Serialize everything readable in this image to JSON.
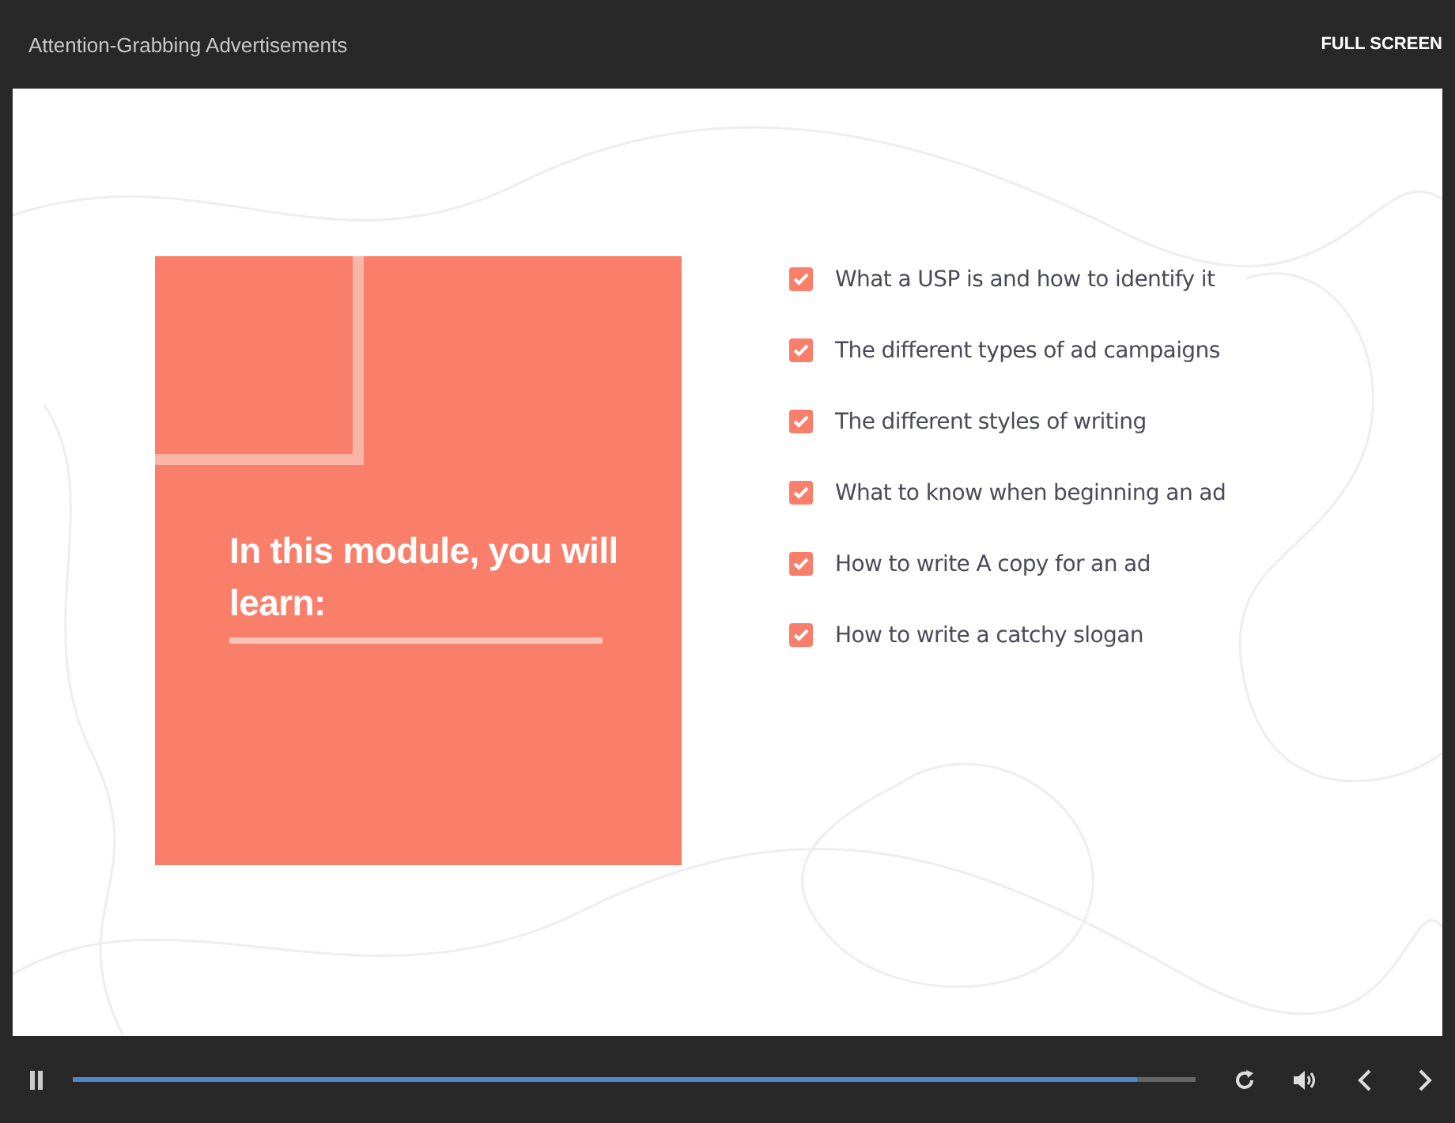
{
  "header": {
    "title": "Attention-Grabbing Advertisements",
    "fullscreen_label": "FULL SCREEN"
  },
  "slide": {
    "card_title": "In this module, you will learn:",
    "items": [
      {
        "label": "What a USP is and how to identify it",
        "checked": true
      },
      {
        "label": "The different types of ad campaigns",
        "checked": true
      },
      {
        "label": "The different styles of writing",
        "checked": true
      },
      {
        "label": "What to know when beginning an ad",
        "checked": true
      },
      {
        "label": "How to write A copy for an ad",
        "checked": true
      },
      {
        "label": "How to write a catchy slogan",
        "checked": true
      }
    ]
  },
  "player": {
    "playing": true,
    "progress": {
      "level": 0.948
    }
  }
}
